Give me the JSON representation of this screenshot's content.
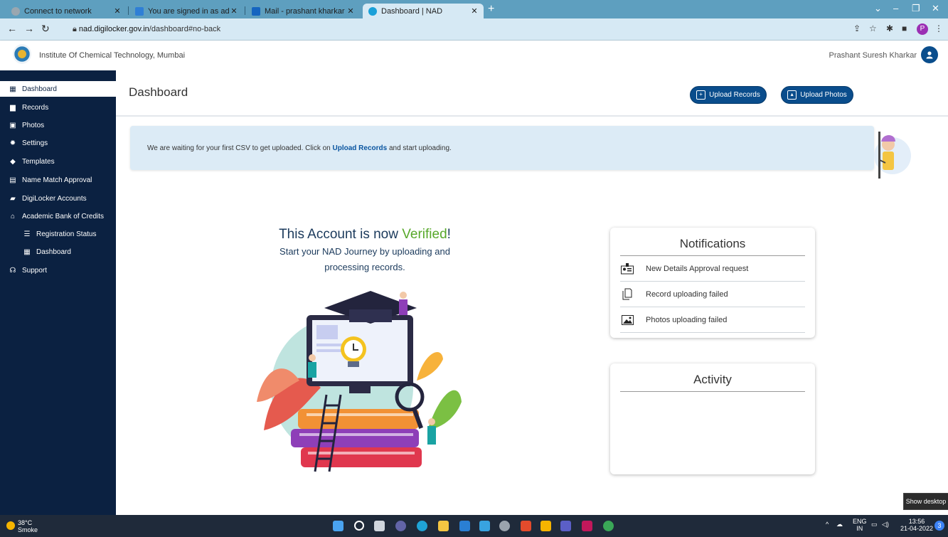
{
  "browser": {
    "tabs": [
      {
        "label": "Connect to network",
        "color": "#9aa7b0"
      },
      {
        "label": "You are signed in as adean.ap",
        "color": "#2f7fd6"
      },
      {
        "label": "Mail - prashant kharkar - Outlook",
        "color": "#1565c0"
      },
      {
        "label": "Dashboard | NAD",
        "color": "#1aa0d8"
      }
    ],
    "url_host": "nad.digilocker.gov.in",
    "url_path": "/dashboard#no-back",
    "profile_initial": "P"
  },
  "header": {
    "institute": "Institute Of Chemical Technology, Mumbai",
    "user_name": "Prashant Suresh Kharkar"
  },
  "sidebar": {
    "items": [
      {
        "label": "Dashboard",
        "icon": "calendar-icon",
        "active": true
      },
      {
        "label": "Records",
        "icon": "document-icon"
      },
      {
        "label": "Photos",
        "icon": "image-icon"
      },
      {
        "label": "Settings",
        "icon": "gear-icon"
      },
      {
        "label": "Templates",
        "icon": "tag-icon"
      },
      {
        "label": "Name Match Approval",
        "icon": "id-card-icon"
      },
      {
        "label": "DigiLocker Accounts",
        "icon": "folder-icon"
      },
      {
        "label": "Academic Bank of Credits",
        "icon": "bank-icon"
      },
      {
        "label": "Registration Status",
        "icon": "list-icon",
        "sub": true
      },
      {
        "label": "Dashboard",
        "icon": "calendar-icon",
        "sub": true
      },
      {
        "label": "Support",
        "icon": "headset-icon"
      }
    ]
  },
  "main": {
    "title": "Dashboard",
    "upload_records_label": "Upload Records",
    "upload_photos_label": "Upload Photos",
    "banner_prefix": "We are waiting for your first CSV to get uploaded. Click on ",
    "banner_link": "Upload Records",
    "banner_suffix": " and start uploading.",
    "verified_prefix": "This Account is now ",
    "verified_word": "Verified",
    "verified_suffix": "!",
    "verified_sub1": "Start your NAD Journey by uploading and",
    "verified_sub2": "processing records."
  },
  "notifications": {
    "title": "Notifications",
    "items": [
      {
        "label": "New Details Approval request",
        "icon": "approval-icon"
      },
      {
        "label": "Record uploading failed",
        "icon": "file-copy-icon"
      },
      {
        "label": "Photos uploading failed",
        "icon": "photo-icon"
      }
    ]
  },
  "activity": {
    "title": "Activity"
  },
  "taskbar": {
    "temp": "38°C",
    "weather": "Smoke",
    "lang1": "ENG",
    "lang2": "IN",
    "time": "13:56",
    "date": "21-04-2022",
    "notif_count": "3",
    "show_desktop": "Show desktop"
  },
  "colors": {
    "sidebar": "#0b2141",
    "primary": "#0a4d8c",
    "verified": "#57a82a",
    "banner": "#dcebf6"
  }
}
